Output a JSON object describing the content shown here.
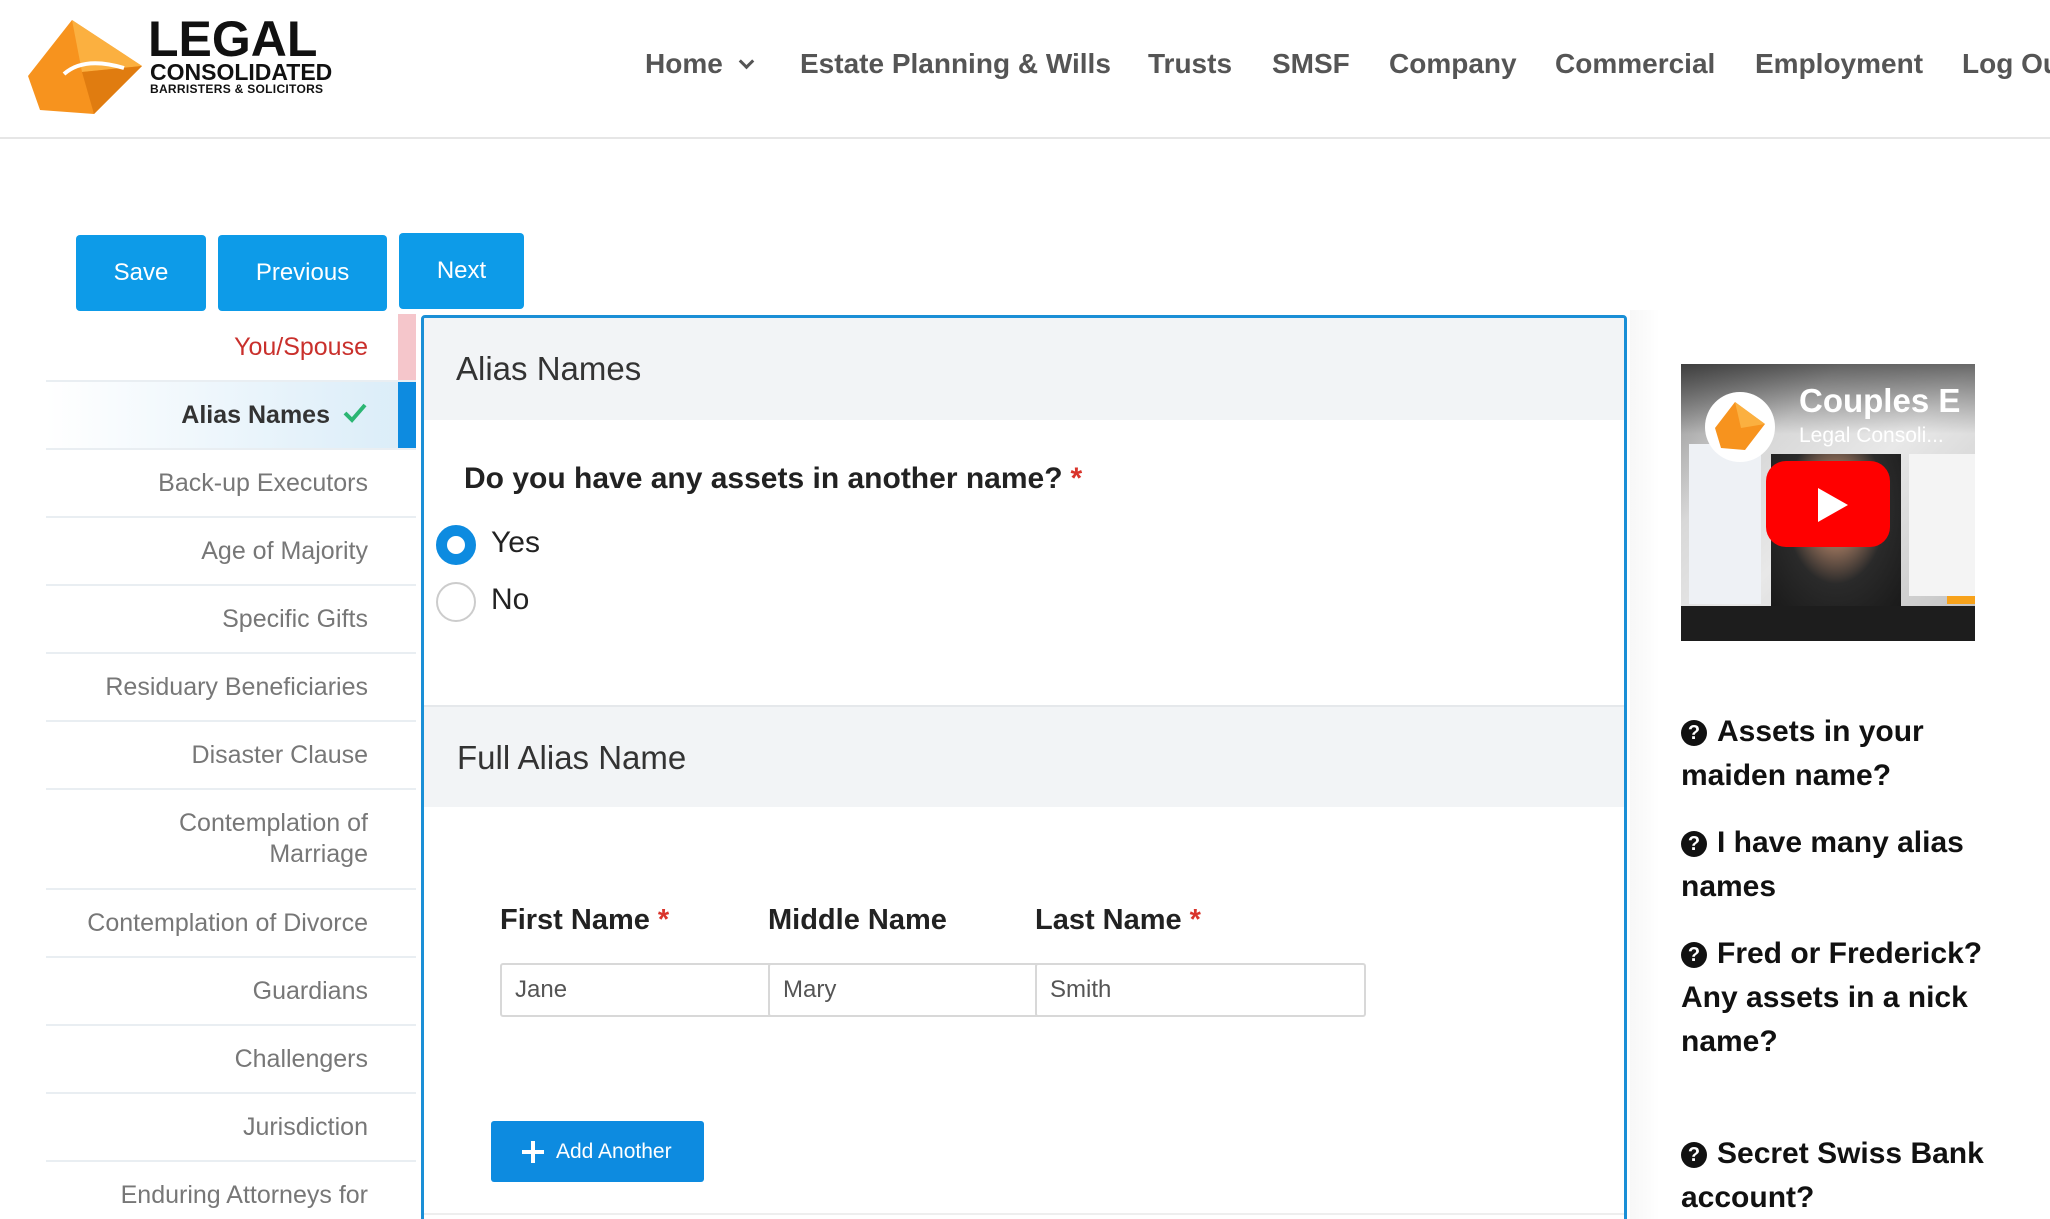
{
  "brand": {
    "logo_main": "LEGAL",
    "logo_sub": "CONSOLIDATED",
    "logo_tagline": "BARRISTERS & SOLICITORS",
    "accent_color": "#f7931e"
  },
  "nav": {
    "items": [
      "Home",
      "Estate Planning & Wills",
      "Trusts",
      "SMSF",
      "Company",
      "Commercial",
      "Employment",
      "Log Ou"
    ]
  },
  "toolbar": {
    "save_label": "Save",
    "previous_label": "Previous",
    "next_label": "Next",
    "button_color": "#0d9be8"
  },
  "sidebar": {
    "items": [
      {
        "label": "You/Spouse",
        "state": "error"
      },
      {
        "label": "Alias Names",
        "state": "active-complete"
      },
      {
        "label": "Back-up Executors",
        "state": ""
      },
      {
        "label": "Age of Majority",
        "state": ""
      },
      {
        "label": "Specific Gifts",
        "state": ""
      },
      {
        "label": "Residuary Beneficiaries",
        "state": ""
      },
      {
        "label": "Disaster Clause",
        "state": ""
      },
      {
        "label": "Contemplation of",
        "label2": "Marriage",
        "state": ""
      },
      {
        "label": "Contemplation of Divorce",
        "state": ""
      },
      {
        "label": "Guardians",
        "state": ""
      },
      {
        "label": "Challengers",
        "state": ""
      },
      {
        "label": "Jurisdiction",
        "state": ""
      },
      {
        "label": "Enduring Attorneys for",
        "state": ""
      }
    ]
  },
  "form": {
    "section_title": "Alias Names",
    "question": "Do you have any assets in another name?",
    "required_mark": "*",
    "options": [
      {
        "label": "Yes",
        "selected": true
      },
      {
        "label": "No",
        "selected": false
      }
    ],
    "subsection_title": "Full Alias Name",
    "fields": {
      "first_name": {
        "label": "First Name",
        "required": true,
        "value": "Jane"
      },
      "middle_name": {
        "label": "Middle Name",
        "required": false,
        "value": "Mary"
      },
      "last_name": {
        "label": "Last Name",
        "required": true,
        "value": "Smith"
      }
    },
    "add_another_label": "Add Another"
  },
  "video": {
    "title": "Couples E",
    "channel": "Legal Consoli..."
  },
  "faq": {
    "items": [
      "Assets in your maiden name?",
      "I have many alias names",
      "Fred or Frederick? Any assets in a nick name?",
      "Secret Swiss Bank account?"
    ],
    "icon": "question-circle-icon"
  }
}
